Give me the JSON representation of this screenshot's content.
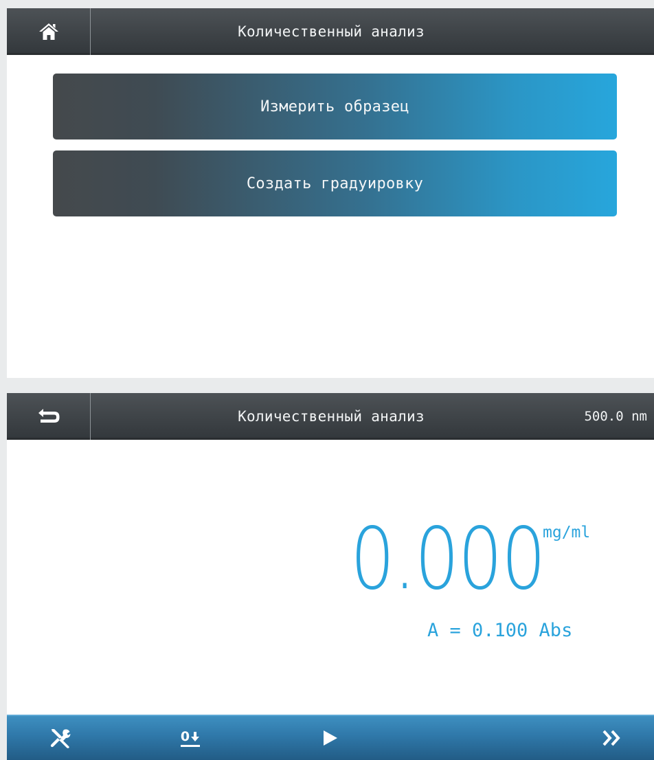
{
  "screen1": {
    "header": {
      "home_icon": "home-icon",
      "title": "Количественный анализ"
    },
    "menu": [
      {
        "label": "Измерить образец"
      },
      {
        "label": "Создать градуировку"
      }
    ]
  },
  "screen2": {
    "header": {
      "back_icon": "back-arrow-icon",
      "title": "Количественный анализ",
      "wavelength": "500.0 nm"
    },
    "reading": {
      "value": "0.000",
      "unit": "mg/ml",
      "absorbance": "A = 0.100 Abs"
    },
    "toolbar": {
      "tools_icon": "tools-icon",
      "zero_label": "0",
      "zero_icon": "zero-arrow-icon",
      "play_icon": "play-icon",
      "next_icon": "double-chevron-right-icon"
    }
  },
  "colors": {
    "accent": "#2aa3dc",
    "header_dark": "#3e4347",
    "toolbar_blue": "#2f78a9",
    "button_left": "#45494c",
    "button_right": "#27a6dc"
  }
}
